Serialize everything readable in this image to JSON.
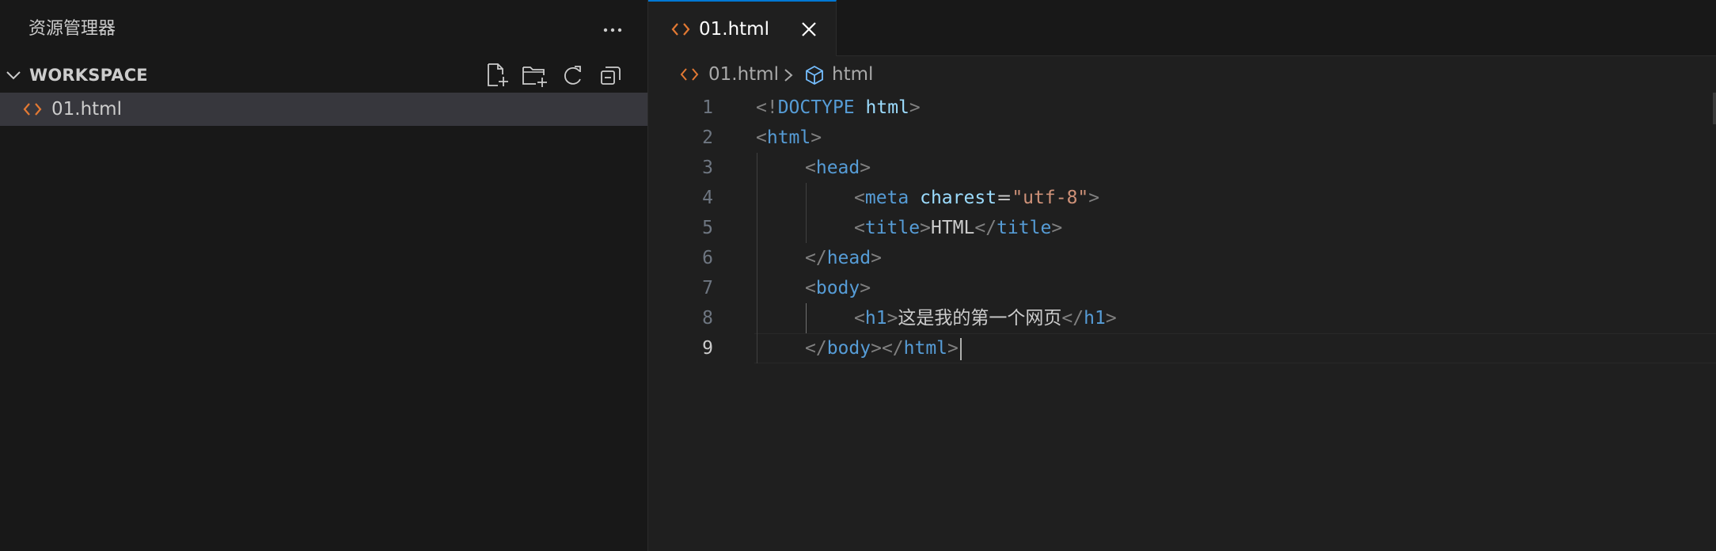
{
  "sidebar": {
    "title": "资源管理器",
    "section_title": "WORKSPACE",
    "files": [
      {
        "name": "01.html"
      }
    ]
  },
  "tab": {
    "label": "01.html"
  },
  "breadcrumb": {
    "file": "01.html",
    "symbol": "html"
  },
  "editor": {
    "line_numbers": [
      "1",
      "2",
      "3",
      "4",
      "5",
      "6",
      "7",
      "8",
      "9"
    ],
    "active_line": 9,
    "code": {
      "l1": {
        "a": "<!",
        "b": "DOCTYPE",
        "c": " ",
        "d": "html",
        "e": ">"
      },
      "l2": {
        "a": "<",
        "b": "html",
        "c": ">"
      },
      "l3": {
        "a": "<",
        "b": "head",
        "c": ">"
      },
      "l4": {
        "a": "<",
        "b": "meta",
        "c": " ",
        "d": "charest",
        "e": "=",
        "f": "\"utf-8\"",
        "g": ">"
      },
      "l5": {
        "a": "<",
        "b": "title",
        "c": ">",
        "d": "HTML",
        "e": "</",
        "f": "title",
        "g": ">"
      },
      "l6": {
        "a": "</",
        "b": "head",
        "c": ">"
      },
      "l7": {
        "a": "<",
        "b": "body",
        "c": ">"
      },
      "l8": {
        "a": "<",
        "b": "h1",
        "c": ">",
        "d": "这是我的第一个网页",
        "e": "</",
        "f": "h1",
        "g": ">"
      },
      "l9": {
        "a": "</",
        "b": "body",
        "c": "></",
        "d": "html",
        "e": ">"
      }
    }
  },
  "colors": {
    "accent": "#0078d4",
    "html_icon": "#e37933",
    "tag": "#569cd6",
    "attribute": "#9cdcfe",
    "string": "#ce9178"
  }
}
